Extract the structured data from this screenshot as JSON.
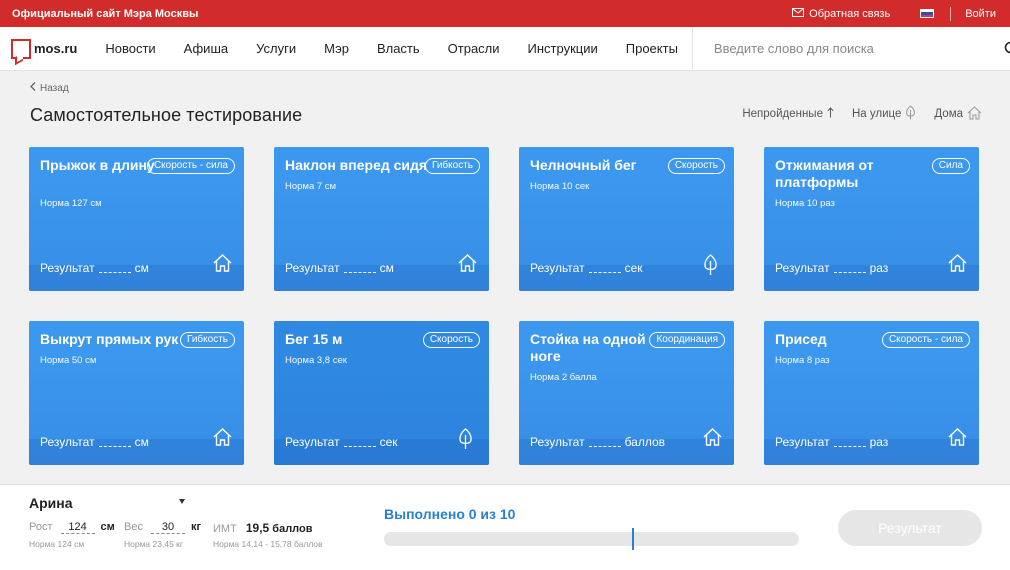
{
  "topbar": {
    "site_name": "Официальный сайт Мэра Москвы",
    "feedback": "Обратная связь",
    "login": "Войти",
    "colors": {
      "bar": "#d22b2b"
    }
  },
  "nav": {
    "logo_text": "mos.ru",
    "items": [
      "Новости",
      "Афиша",
      "Услуги",
      "Мэр",
      "Власть",
      "Отрасли",
      "Инструкции",
      "Проекты"
    ],
    "search_placeholder": "Введите слово для поиска"
  },
  "page": {
    "back_label": "Назад",
    "title": "Самостоятельное тестирование",
    "filters": [
      {
        "label": "Непройденные",
        "icon": "arrow-up-icon"
      },
      {
        "label": "На улице",
        "icon": "tree-icon"
      },
      {
        "label": "Дома",
        "icon": "house-icon"
      }
    ]
  },
  "cards": [
    {
      "title": "Прыжок в длину",
      "badge": "Скорость - сила",
      "norm": "Норма 127 см",
      "result_label": "Результат",
      "unit": "см",
      "icon": "house-icon"
    },
    {
      "title": "Наклон вперед сидя",
      "badge": "Гибкость",
      "norm": "Норма 7 см",
      "result_label": "Результат",
      "unit": "см",
      "icon": "house-icon"
    },
    {
      "title": "Челночный бег",
      "badge": "Скорость",
      "norm": "Норма 10 сек",
      "result_label": "Результат",
      "unit": "сек",
      "icon": "tree-icon"
    },
    {
      "title": "Отжимания от платформы",
      "badge": "Сила",
      "norm": "Норма 10 раз",
      "result_label": "Результат",
      "unit": "раз",
      "icon": "house-icon"
    },
    {
      "title": "Выкрут прямых рук",
      "badge": "Гибкость",
      "norm": "Норма 50 см",
      "result_label": "Результат",
      "unit": "см",
      "icon": "house-icon"
    },
    {
      "title": "Бег 15 м",
      "badge": "Скорость",
      "norm": "Норма 3,8 сек",
      "result_label": "Результат",
      "unit": "сек",
      "icon": "tree-icon"
    },
    {
      "title": "Стойка на одной ноге",
      "badge": "Координация",
      "norm": "Норма 2 балла",
      "result_label": "Результат",
      "unit": "баллов",
      "icon": "house-icon"
    },
    {
      "title": "Присед",
      "badge": "Скорость - сила",
      "norm": "Норма 8 раз",
      "result_label": "Результат",
      "unit": "раз",
      "icon": "house-icon"
    }
  ],
  "panel": {
    "athlete_name": "Арина",
    "height": {
      "label": "Рост",
      "value": "124",
      "unit": "см",
      "norm": "Норма 124 см"
    },
    "weight": {
      "label": "Вес",
      "value": "30",
      "unit": "кг",
      "norm": "Норма 23,45 кг"
    },
    "bmi": {
      "label": "ИМТ",
      "value": "19,5",
      "unit": "баллов",
      "norm": "Норма 14,14 - 15,78 баллов"
    },
    "progress_text": "Выполнено 0 из 10",
    "progress_done": 0,
    "progress_total": 10,
    "result_button": "Результат"
  }
}
